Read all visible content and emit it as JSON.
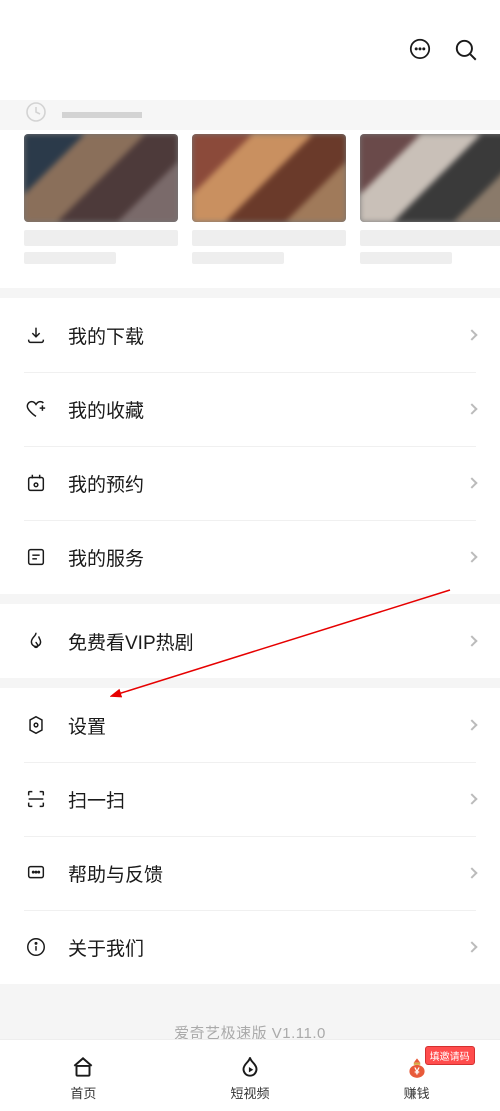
{
  "menus": {
    "group1": [
      {
        "name": "downloads",
        "label": "我的下载"
      },
      {
        "name": "favorites",
        "label": "我的收藏"
      },
      {
        "name": "reservations",
        "label": "我的预约"
      },
      {
        "name": "services",
        "label": "我的服务"
      }
    ],
    "group2": [
      {
        "name": "free-vip",
        "label": "免费看VIP热剧"
      }
    ],
    "group3": [
      {
        "name": "settings",
        "label": "设置"
      },
      {
        "name": "scan",
        "label": "扫一扫"
      },
      {
        "name": "help-feedback",
        "label": "帮助与反馈"
      },
      {
        "name": "about",
        "label": "关于我们"
      }
    ]
  },
  "version_text": "爱奇艺极速版 V1.11.0",
  "bottom_nav": {
    "home": "首页",
    "short_video": "短视频",
    "earn": "赚钱",
    "earn_badge": "填邀请码"
  },
  "colors": {
    "text": "#1a1a1a",
    "muted": "#aaa",
    "divider": "#f0f0f0",
    "accent_red": "#ff4d4d"
  }
}
